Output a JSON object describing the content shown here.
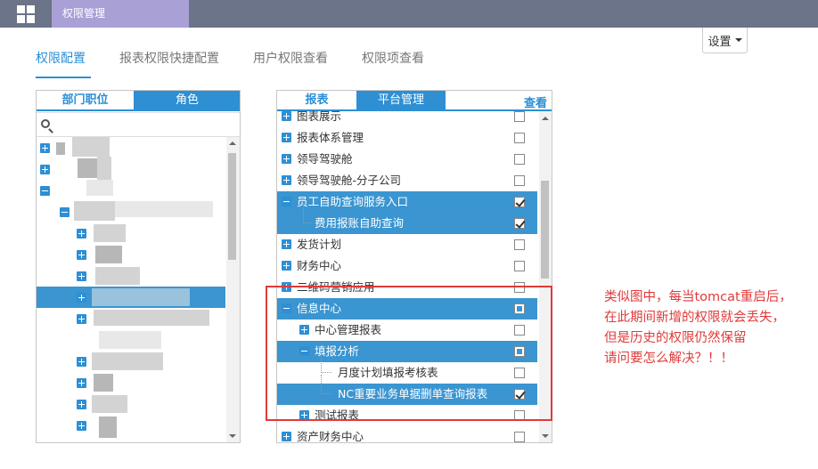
{
  "header": {
    "app_tab": "权限管理"
  },
  "nav_tabs": [
    "权限配置",
    "报表权限快捷配置",
    "用户权限查看",
    "权限项查看"
  ],
  "settings_label": "设置",
  "left_panel": {
    "tabs": [
      "部门职位",
      "角色"
    ],
    "search_placeholder": ""
  },
  "right_panel": {
    "tabs": [
      "报表",
      "平台管理"
    ],
    "view_link": "查看",
    "items": [
      {
        "label": "图表展示",
        "expander": "plus",
        "depth": 0,
        "selected": false,
        "check": "none"
      },
      {
        "label": "报表体系管理",
        "expander": "plus",
        "depth": 0,
        "selected": false,
        "check": "none"
      },
      {
        "label": "领导驾驶舱",
        "expander": "plus",
        "depth": 0,
        "selected": false,
        "check": "none"
      },
      {
        "label": "领导驾驶舱-分子公司",
        "expander": "plus",
        "depth": 0,
        "selected": false,
        "check": "none"
      },
      {
        "label": "员工自助查询服务入口",
        "expander": "minus",
        "depth": 0,
        "selected": true,
        "check": "checked"
      },
      {
        "label": "费用报账自助查询",
        "expander": "none",
        "depth": 1,
        "selected": true,
        "check": "checked"
      },
      {
        "label": "发货计划",
        "expander": "plus",
        "depth": 0,
        "selected": false,
        "check": "none"
      },
      {
        "label": "财务中心",
        "expander": "plus",
        "depth": 0,
        "selected": false,
        "check": "none"
      },
      {
        "label": "二维码营销应用",
        "expander": "plus",
        "depth": 0,
        "selected": false,
        "check": "none"
      },
      {
        "label": "信息中心",
        "expander": "minus",
        "depth": 0,
        "selected": true,
        "check": "partial"
      },
      {
        "label": "中心管理报表",
        "expander": "plus",
        "depth": 1,
        "selected": false,
        "check": "none"
      },
      {
        "label": "填报分析",
        "expander": "minus",
        "depth": 1,
        "selected": true,
        "check": "partial"
      },
      {
        "label": "月度计划填报考核表",
        "expander": "none",
        "depth": 2,
        "selected": false,
        "check": "none"
      },
      {
        "label": "NC重要业务单据删单查询报表",
        "expander": "none",
        "depth": 2,
        "selected": true,
        "check": "checked"
      },
      {
        "label": "测试报表",
        "expander": "plus",
        "depth": 1,
        "selected": false,
        "check": "none"
      },
      {
        "label": "资产财务中心",
        "expander": "plus",
        "depth": 0,
        "selected": false,
        "check": "none"
      }
    ]
  },
  "annotation": {
    "lines": [
      "类似图中，每当tomcat重启后，",
      "在此期间新增的权限就会丢失，",
      "但是历史的权限仍然保留",
      "请问要怎么解决？！！"
    ],
    "color": "#e03a3a"
  },
  "colors": {
    "accent": "#2a8fd6",
    "selected_row": "#3a95d1",
    "topbar": "#6b7488",
    "app_tab": "#a9a0d6"
  }
}
